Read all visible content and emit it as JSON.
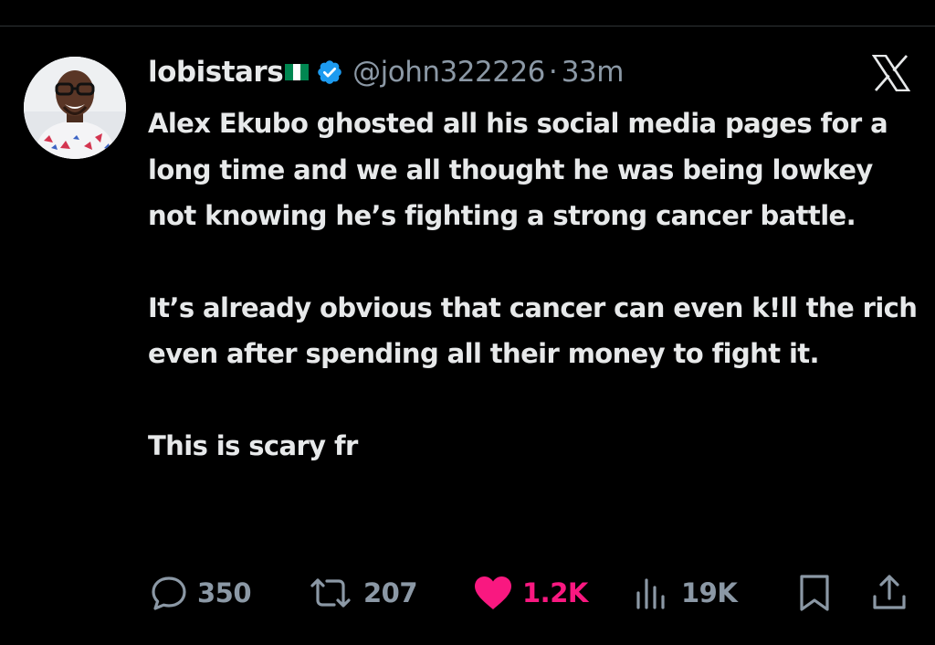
{
  "tweet": {
    "display_name": "lobistars",
    "handle": "@john322226",
    "separator": "·",
    "time": "33m",
    "paragraphs": [
      "Alex Ekubo ghosted all his social media pages for a long time and we all thought he was being lowkey not knowing he’s fighting a strong cancer battle.",
      "It’s already obvious that cancer can even k!ll the rich even after spending all their money to fight it.",
      "This is scary fr"
    ]
  },
  "actions": {
    "replies": "350",
    "reposts": "207",
    "likes": "1.2K",
    "views": "19K"
  },
  "icons": {
    "reply": "reply-icon",
    "repost": "repost-icon",
    "like": "heart-icon",
    "views": "views-icon",
    "bookmark": "bookmark-icon",
    "share": "share-icon",
    "brand": "x-logo-icon",
    "verified": "verified-badge-icon",
    "flag": "nigeria-flag-icon"
  },
  "colors": {
    "background": "#000000",
    "text": "#e7e9ea",
    "muted": "#8b98a5",
    "verified": "#1d9bf0",
    "like": "#f91880",
    "flag_green": "#008751"
  }
}
